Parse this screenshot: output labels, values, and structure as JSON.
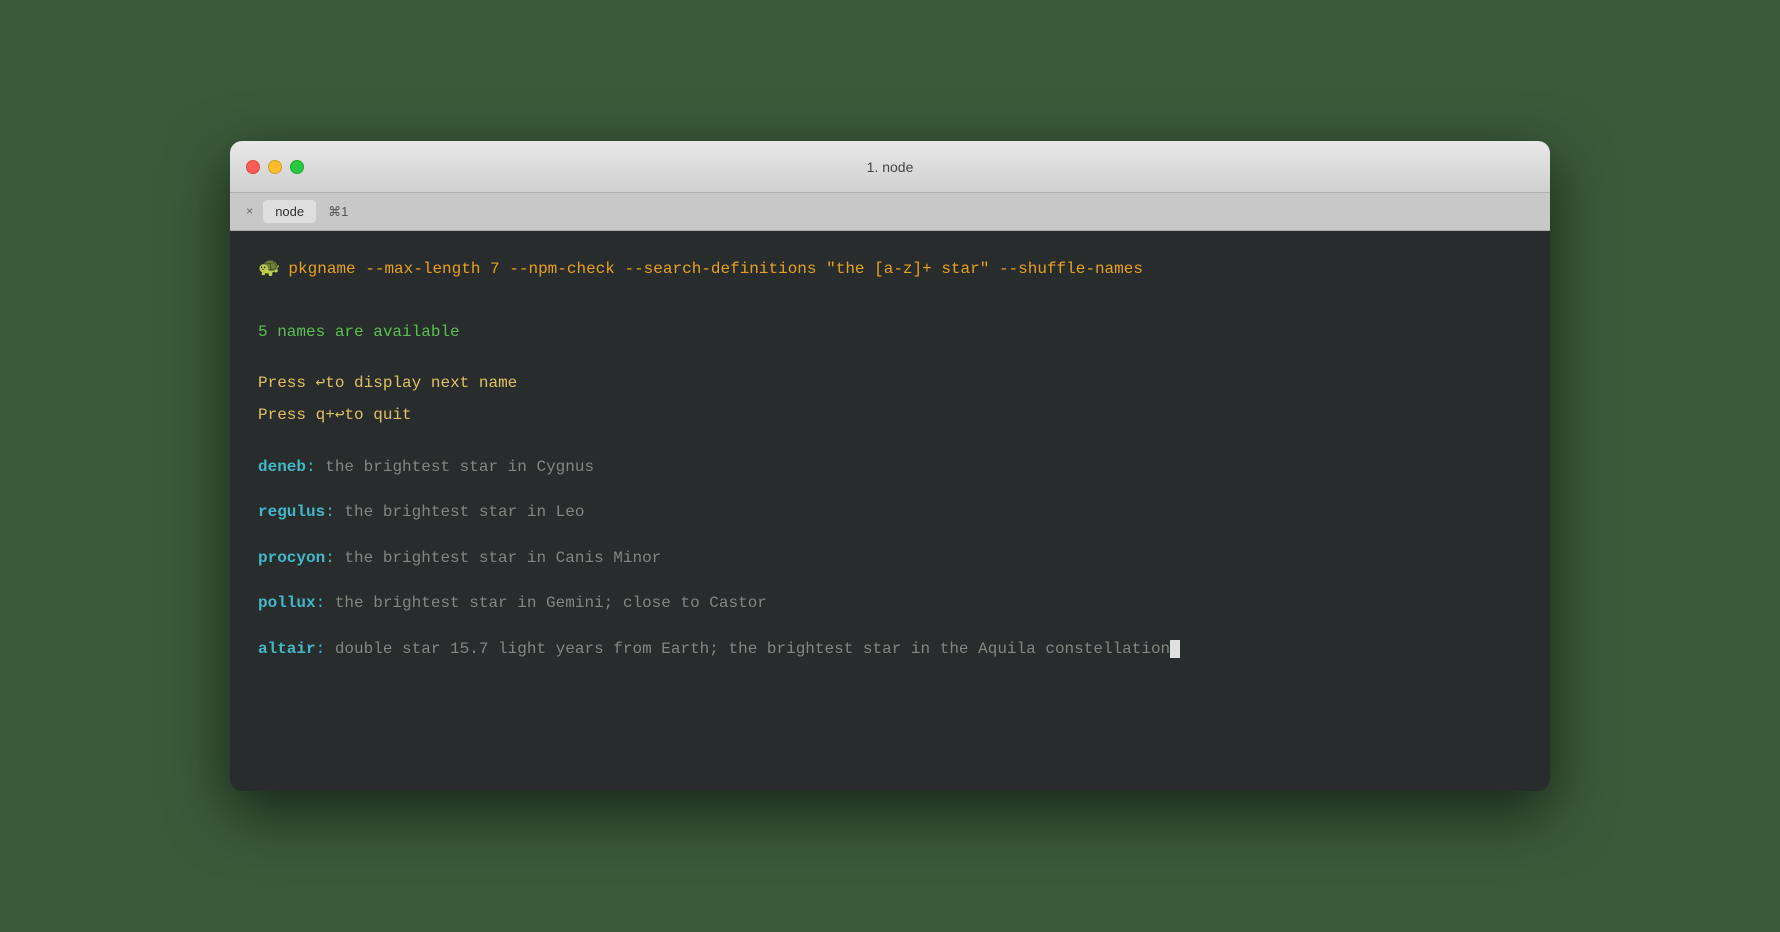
{
  "window": {
    "title": "1. node",
    "tab_label": "node",
    "tab_shortcut": "⌘1",
    "tab_close": "×"
  },
  "terminal": {
    "command": "pkgname --max-length 7 --npm-check --search-definitions \"the [a-z]+ star\" --shuffle-names",
    "turtle": "🐢",
    "available_line": "5 names are available",
    "press_next": "Press ↩to display next name",
    "press_quit": "Press q+↩to quit",
    "results": [
      {
        "name": "deneb",
        "colon": ":",
        "desc": " the brightest star in Cygnus"
      },
      {
        "name": "regulus",
        "colon": ":",
        "desc": " the brightest star in Leo"
      },
      {
        "name": "procyon",
        "colon": ":",
        "desc": " the brightest star in Canis Minor"
      },
      {
        "name": "pollux",
        "colon": ":",
        "desc": " the brightest star in Gemini; close to Castor"
      },
      {
        "name": "altair",
        "colon": ":",
        "desc": " double star 15.7 light years from Earth; the brightest star in the Aquila constellation"
      }
    ]
  },
  "colors": {
    "background": "#3a5a3a",
    "terminal_bg": "#282c2c",
    "command_color": "#e8a020",
    "available_color": "#58c050",
    "press_color_yellow": "#e0c060",
    "press_color_gray": "#808880",
    "name_color": "#40b8c8",
    "desc_color": "#808880"
  }
}
